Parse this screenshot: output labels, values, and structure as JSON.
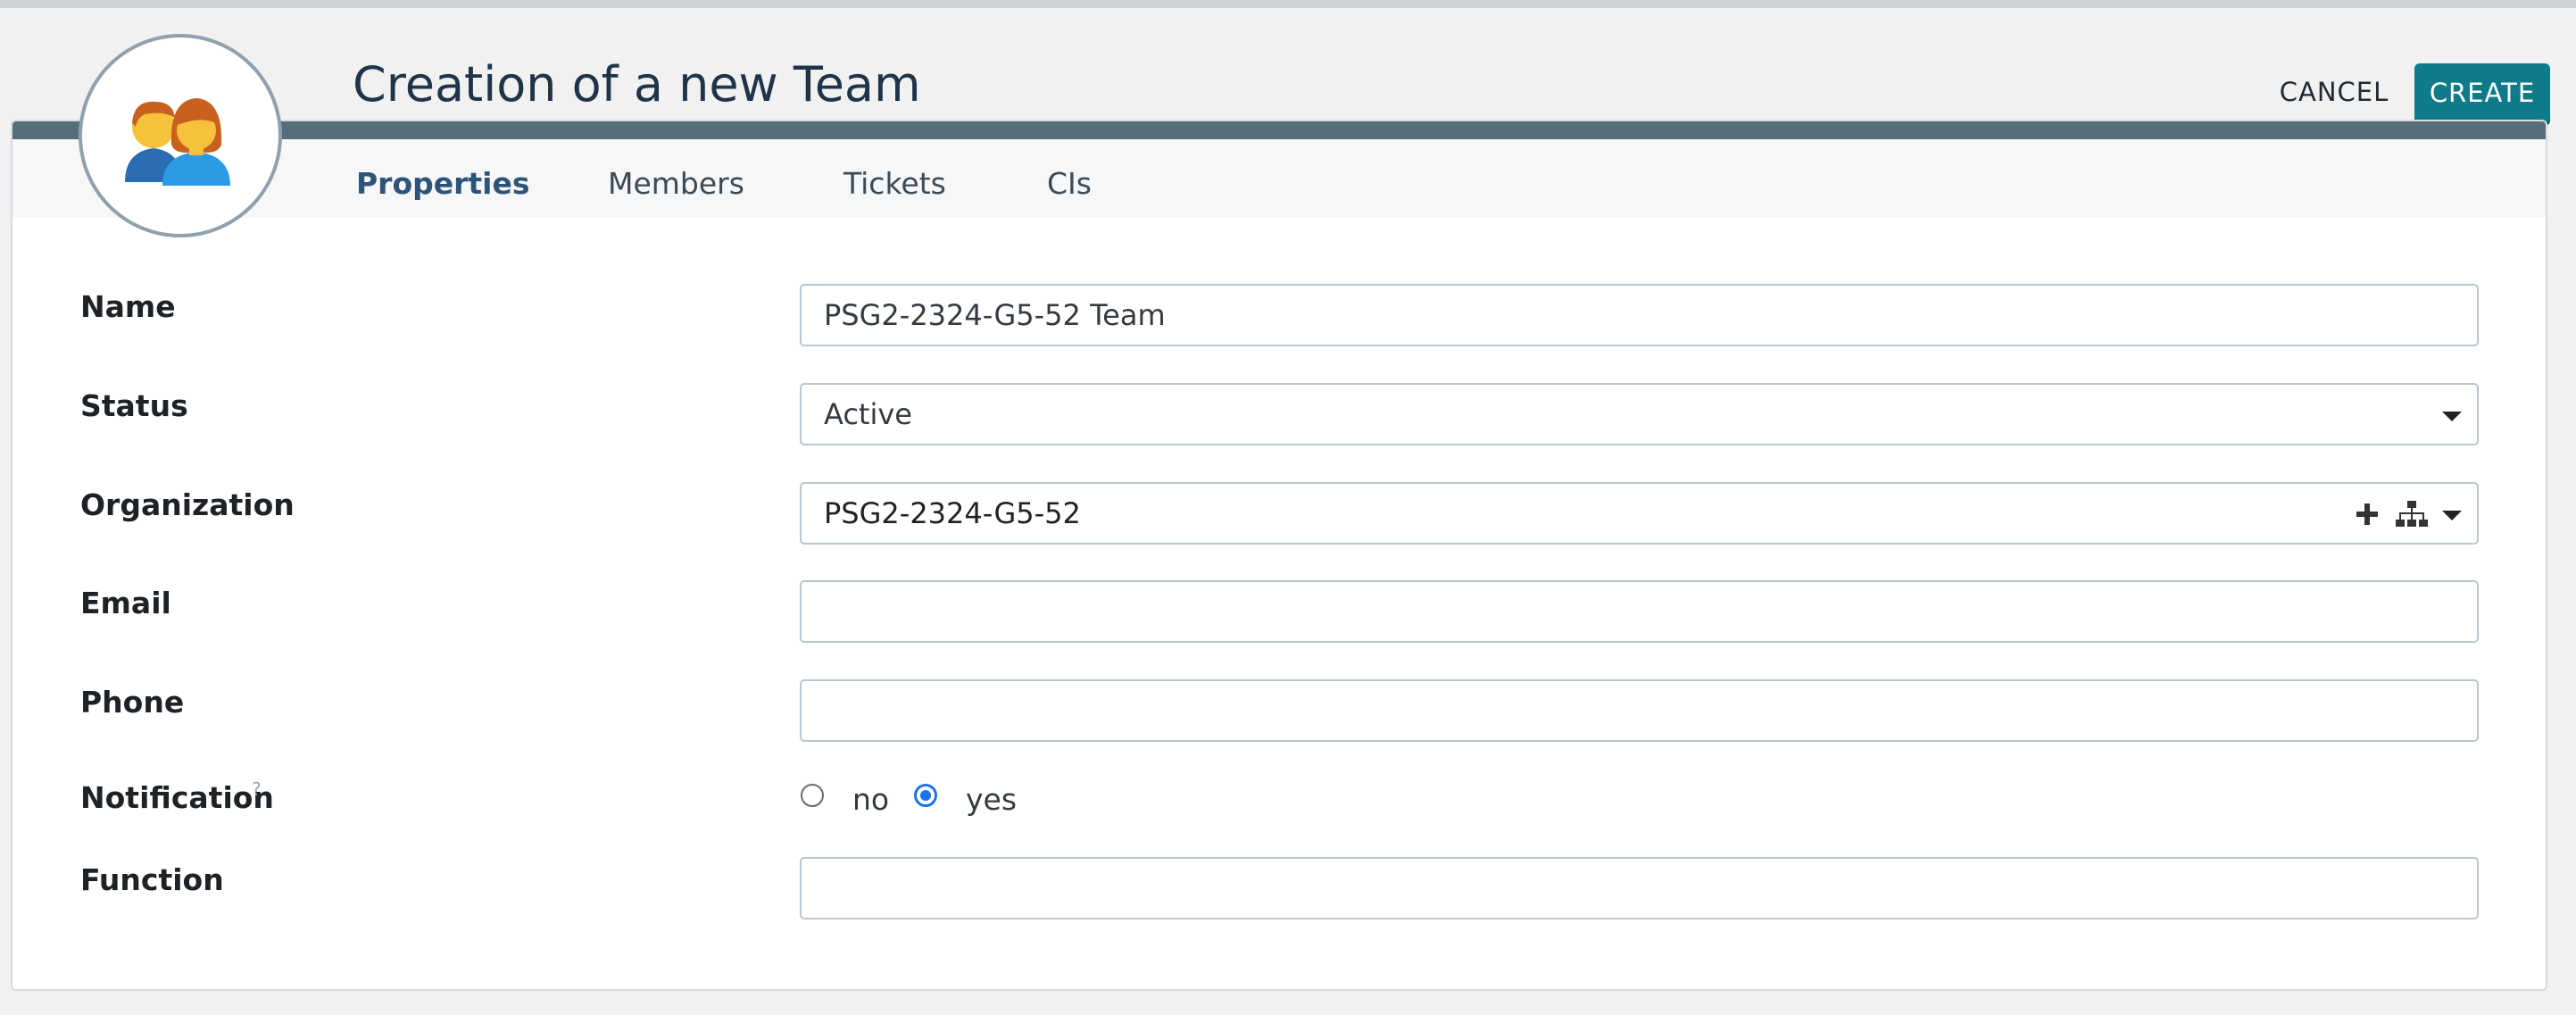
{
  "header": {
    "title": "Creation of a new Team",
    "cancel_label": "CANCEL",
    "create_label": "CREATE",
    "avatar_icon": "team-people-icon"
  },
  "tabs": [
    {
      "label": "Properties",
      "active": true
    },
    {
      "label": "Members",
      "active": false
    },
    {
      "label": "Tickets",
      "active": false
    },
    {
      "label": "CIs",
      "active": false
    }
  ],
  "form": {
    "name": {
      "label": "Name",
      "value": "PSG2-2324-G5-52 Team"
    },
    "status": {
      "label": "Status",
      "value": "Active"
    },
    "organization": {
      "label": "Organization",
      "value": "PSG2-2324-G5-52",
      "icons": [
        "plus-icon",
        "hierarchy-icon",
        "chevron-down-icon"
      ]
    },
    "email": {
      "label": "Email",
      "value": ""
    },
    "phone": {
      "label": "Phone",
      "value": ""
    },
    "notification": {
      "label": "Notification",
      "help": "?",
      "options": [
        "no",
        "yes"
      ],
      "selected": "yes"
    },
    "function": {
      "label": "Function",
      "value": ""
    }
  },
  "colors": {
    "accent": "#0f7b8a",
    "header_strip": "#566d7a",
    "active_tab": "#2d5379"
  }
}
